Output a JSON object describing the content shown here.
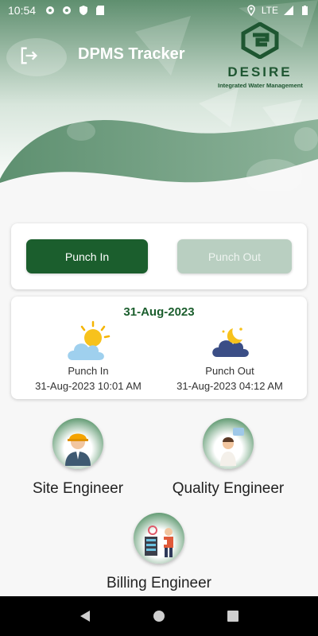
{
  "status_bar": {
    "time": "10:54",
    "network": "LTE"
  },
  "header": {
    "title": "DPMS Tracker",
    "logo_text": "DESIRE",
    "logo_tagline": "Integrated Water Management"
  },
  "punch": {
    "in_label": "Punch In",
    "out_label": "Punch Out"
  },
  "attendance": {
    "date": "31-Aug-2023",
    "punch_in_label": "Punch In",
    "punch_in_time": "31-Aug-2023 10:01 AM",
    "punch_out_label": "Punch Out",
    "punch_out_time": "31-Aug-2023 04:12 AM"
  },
  "roles": [
    {
      "label": "Site Engineer"
    },
    {
      "label": "Quality Engineer"
    },
    {
      "label": "Billing Engineer"
    }
  ],
  "colors": {
    "primary": "#1b5e2d",
    "disabled": "#b9cfc1",
    "header": "#6f9a7e"
  }
}
